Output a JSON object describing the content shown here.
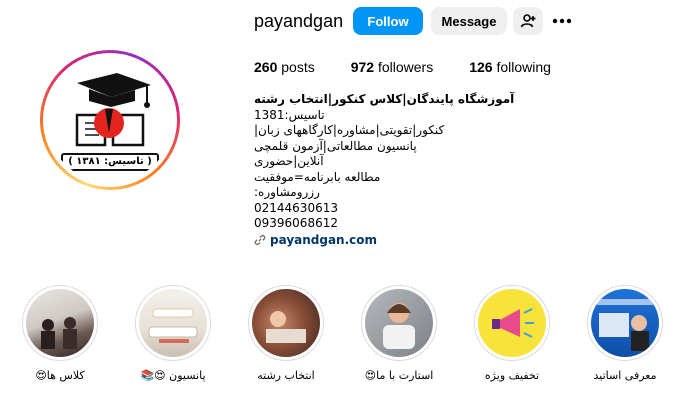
{
  "profile": {
    "username": "payandgan",
    "follow_label": "Follow",
    "message_label": "Message",
    "avatar_caption": "( تاسیس: ۱۳۸۱ )"
  },
  "stats": {
    "posts": "260",
    "posts_label": "posts",
    "followers": "972",
    "followers_label": "followers",
    "following": "126",
    "following_label": "following"
  },
  "bio": {
    "name": "آموزشگاه پایندگان|کلاس کنکور|انتخاب رشته",
    "lines": [
      "تاسیس:1381",
      "کنکور|تقویتی|مشاوره|کارگاههای زبان|",
      "پانسیون مطالعاتی|آزمون قلمچی",
      "آنلاین|حضوری",
      "مطالعه بابرنامه=موفقیت",
      "رزرومشاوره:",
      "02144630613",
      "09396068612"
    ],
    "link": "payandgan.com"
  },
  "highlights": [
    {
      "label": "کلاس ها😍"
    },
    {
      "label": "پانسیون 😍📚"
    },
    {
      "label": "انتخاب رشته"
    },
    {
      "label": "استارت با ما😍"
    },
    {
      "label": "تخفیف ویژه"
    },
    {
      "label": "معرفی اساتید"
    }
  ],
  "colors": {
    "accent": "#0095f6",
    "secondary_button": "#efefef",
    "link": "#00376b",
    "highlight_border": "#dbdbdb"
  },
  "icons": {
    "add_user": "add-person-icon",
    "more": "more-horizontal-icon",
    "link": "link-icon"
  }
}
